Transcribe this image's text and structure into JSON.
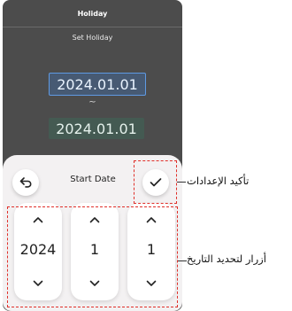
{
  "screen": {
    "title": "Holiday",
    "subtitle": "Set Holiday",
    "start_date": "2024.01.01",
    "separator": "~",
    "end_date": "2024.01.01"
  },
  "picker": {
    "title": "Start Date",
    "back_icon": "back-arrow-icon",
    "confirm_icon": "checkmark-icon",
    "year": "2024",
    "month": "1",
    "day": "1"
  },
  "annotations": {
    "confirm_label": "تأكيد الإعدادات",
    "date_buttons_label": "أزرار لتحديد التاريخ",
    "highlight_color": "#e0302a"
  },
  "colors": {
    "screen_background": "#4c4c4c",
    "start_date_border": "#5f9ae3",
    "sheet_background": "#f3f1f2"
  }
}
